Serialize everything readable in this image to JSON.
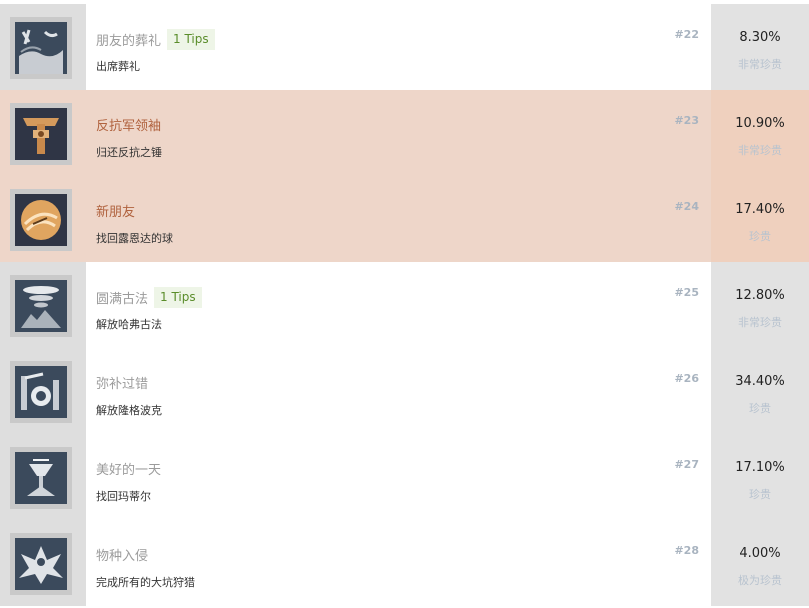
{
  "achievements": [
    {
      "title": "朋友的葬礼",
      "tips": "1 Tips",
      "desc": "出席葬礼",
      "number": "#22",
      "percent": "8.30%",
      "rarity": "非常珍贵",
      "highlight": false,
      "icon": "funeral-icon"
    },
    {
      "title": "反抗军领袖",
      "tips": "",
      "desc": "归还反抗之锤",
      "number": "#23",
      "percent": "10.90%",
      "rarity": "非常珍贵",
      "highlight": true,
      "icon": "hammer-icon"
    },
    {
      "title": "新朋友",
      "tips": "",
      "desc": "找回露恩达的球",
      "number": "#24",
      "percent": "17.40%",
      "rarity": "珍贵",
      "highlight": true,
      "icon": "orb-icon"
    },
    {
      "title": "圆满古法",
      "tips": "1 Tips",
      "desc": "解放哈弗古法",
      "number": "#25",
      "percent": "12.80%",
      "rarity": "非常珍贵",
      "highlight": false,
      "icon": "tornado-icon"
    },
    {
      "title": "弥补过错",
      "tips": "",
      "desc": "解放隆格波克",
      "number": "#26",
      "percent": "34.40%",
      "rarity": "珍贵",
      "highlight": false,
      "icon": "machine-icon"
    },
    {
      "title": "美好的一天",
      "tips": "",
      "desc": "找回玛蒂尔",
      "number": "#27",
      "percent": "17.10%",
      "rarity": "珍贵",
      "highlight": false,
      "icon": "chalice-icon"
    },
    {
      "title": "物种入侵",
      "tips": "",
      "desc": "完成所有的大坑狩猎",
      "number": "#28",
      "percent": "4.00%",
      "rarity": "极为珍贵",
      "highlight": false,
      "icon": "dragon-icon"
    }
  ]
}
